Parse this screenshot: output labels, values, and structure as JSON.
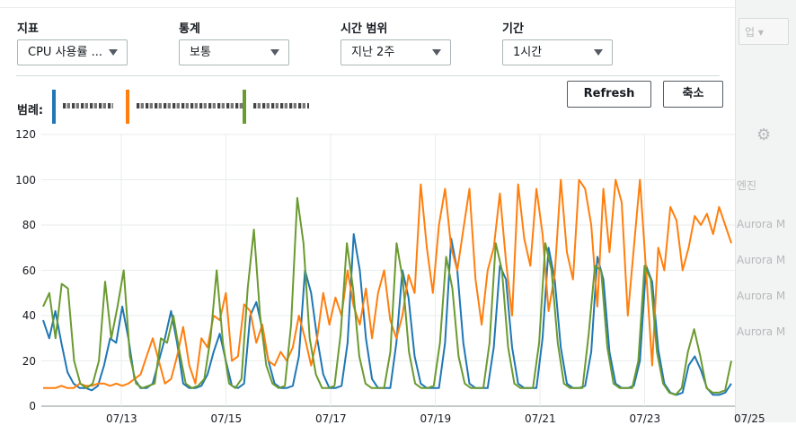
{
  "controls": {
    "metric": {
      "label": "지표",
      "value": "CPU 사용률 ..."
    },
    "statistic": {
      "label": "통계",
      "value": "보통"
    },
    "time_range": {
      "label": "시간 범위",
      "value": "지난 2주"
    },
    "period": {
      "label": "기간",
      "value": "1시간"
    }
  },
  "buttons": {
    "refresh": "Refresh",
    "shrink": "축소"
  },
  "legend": {
    "title": "범례:",
    "items": [
      {
        "color": "#1f77b4"
      },
      {
        "color": "#ff7f0e"
      },
      {
        "color": "#6b9a2f"
      }
    ]
  },
  "background": {
    "button_text": "업",
    "texts": [
      "엔진",
      "Aurora M",
      "Aurora M",
      "Aurora M",
      "Aurora M"
    ]
  },
  "chart_data": {
    "type": "line",
    "ylim": [
      0,
      120
    ],
    "y_ticks": [
      "120",
      "100",
      "80",
      "60",
      "40",
      "20",
      "0"
    ],
    "x_ticks": [
      "07/13",
      "07/15",
      "07/17",
      "07/19",
      "07/21",
      "07/23",
      "07/25"
    ],
    "grid": true,
    "series": [
      {
        "color": "#1f77b4",
        "values": [
          38,
          30,
          42,
          28,
          15,
          10,
          8,
          8,
          7,
          9,
          18,
          30,
          28,
          44,
          30,
          12,
          8,
          8,
          10,
          20,
          30,
          42,
          28,
          10,
          8,
          8,
          9,
          14,
          24,
          32,
          20,
          9,
          8,
          10,
          40,
          46,
          34,
          20,
          10,
          8,
          8,
          9,
          22,
          60,
          50,
          30,
          14,
          8,
          8,
          9,
          28,
          76,
          60,
          30,
          12,
          8,
          8,
          8,
          28,
          60,
          48,
          22,
          10,
          8,
          8,
          8,
          28,
          74,
          60,
          28,
          10,
          8,
          8,
          8,
          26,
          62,
          56,
          26,
          10,
          8,
          8,
          8,
          30,
          70,
          56,
          26,
          10,
          8,
          8,
          9,
          24,
          66,
          56,
          24,
          10,
          8,
          8,
          9,
          20,
          62,
          55,
          25,
          10,
          6,
          5,
          6,
          18,
          22,
          16,
          8,
          5,
          5,
          6,
          10
        ]
      },
      {
        "color": "#ff7f0e",
        "values": [
          8,
          8,
          8,
          9,
          8,
          8,
          10,
          9,
          9,
          10,
          10,
          9,
          10,
          9,
          10,
          12,
          14,
          22,
          30,
          20,
          10,
          12,
          22,
          35,
          18,
          10,
          30,
          26,
          40,
          38,
          50,
          20,
          22,
          45,
          42,
          28,
          36,
          20,
          18,
          24,
          20,
          26,
          40,
          30,
          18,
          30,
          50,
          36,
          48,
          40,
          60,
          44,
          36,
          52,
          30,
          50,
          60,
          38,
          30,
          40,
          58,
          50,
          98,
          70,
          50,
          80,
          96,
          70,
          60,
          78,
          96,
          56,
          36,
          60,
          70,
          94,
          64,
          40,
          98,
          74,
          62,
          96,
          76,
          42,
          58,
          100,
          68,
          56,
          100,
          96,
          80,
          44,
          96,
          68,
          100,
          90,
          40,
          70,
          100,
          60,
          18,
          70,
          60,
          88,
          82,
          60,
          70,
          84,
          80,
          85,
          76,
          88,
          80,
          72
        ]
      },
      {
        "color": "#6b9a2f",
        "values": [
          44,
          50,
          30,
          54,
          52,
          20,
          10,
          8,
          10,
          20,
          55,
          30,
          44,
          60,
          22,
          10,
          8,
          9,
          10,
          30,
          28,
          40,
          24,
          10,
          8,
          9,
          12,
          30,
          60,
          28,
          10,
          8,
          12,
          52,
          78,
          40,
          18,
          10,
          8,
          9,
          36,
          92,
          72,
          30,
          14,
          8,
          8,
          9,
          32,
          72,
          52,
          22,
          10,
          8,
          8,
          8,
          24,
          72,
          56,
          24,
          10,
          8,
          8,
          9,
          28,
          66,
          52,
          22,
          10,
          8,
          8,
          8,
          28,
          72,
          60,
          26,
          10,
          8,
          8,
          8,
          28,
          72,
          60,
          28,
          10,
          8,
          8,
          8,
          32,
          62,
          60,
          26,
          10,
          8,
          8,
          8,
          20,
          62,
          56,
          24,
          10,
          6,
          5,
          8,
          24,
          34,
          22,
          8,
          6,
          6,
          7,
          20
        ]
      }
    ]
  }
}
